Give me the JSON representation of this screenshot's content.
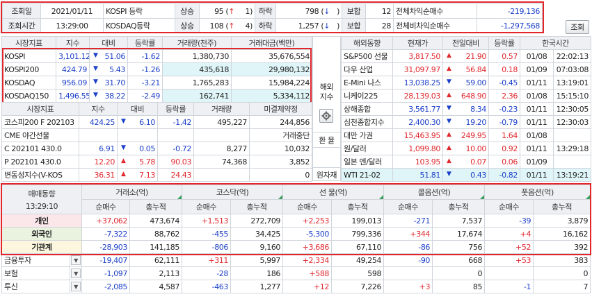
{
  "top": {
    "date_label": "조회일",
    "date_value": "2021/01/11",
    "time_label": "조회시간",
    "time_value": "13:29:00",
    "kospi_label": "KOSPI 등락",
    "kosdaq_label": "KOSDAQ등락",
    "up_label": "상승",
    "down_label": "하락",
    "flat_label": "보합",
    "kospi_up": "95",
    "kospi_up_limit": "1",
    "kospi_down": "798",
    "kospi_flat": "12",
    "kosdaq_up": "108",
    "kosdaq_up_limit": "4",
    "kosdaq_down": "1,257",
    "kosdaq_flat": "28",
    "total_diff_label": "전체차익순매수",
    "total_diff_value": "-219,136",
    "total_nondiff_label": "전체비차익순매수",
    "total_nondiff_value": "-1,297,568",
    "search_button": "조회",
    "up_arrow": "↑",
    "down_arrow": "↓"
  },
  "market": {
    "headers": [
      "시장지표",
      "지수",
      "대비",
      "등락률",
      "거래량(천주)",
      "거래대금(백만)"
    ],
    "rows": [
      {
        "name": "KOSPI",
        "index": "3,101.12",
        "change": "51.06",
        "rate": "-1.62",
        "volume": "1,380,730",
        "amount": "35,676,554"
      },
      {
        "name": "KOSPI200",
        "index": "424.79",
        "change": "5.43",
        "rate": "-1.26",
        "volume": "435,618",
        "amount": "29,980,132"
      },
      {
        "name": "KOSDAQ",
        "index": "956.09",
        "change": "31.70",
        "rate": "-3.21",
        "volume": "1,765,283",
        "amount": "15,984,224"
      },
      {
        "name": "KOSDAQ150",
        "index": "1,496.55",
        "change": "38.22",
        "rate": "-2.49",
        "volume": "162,741",
        "amount": "5,334,112"
      }
    ]
  },
  "futures": {
    "headers": [
      "시장지표",
      "지수",
      "대비",
      "등락률",
      "거래량",
      "미결제약정"
    ],
    "rows": [
      {
        "name": "코스피200 F 202103",
        "index": "424.25",
        "dir": "down",
        "change": "6.10",
        "rate": "-1.42",
        "volume": "495,227",
        "open": "244,856"
      },
      {
        "name": "CME 야간선물",
        "index": "",
        "dir": "",
        "change": "",
        "rate": "",
        "volume": "",
        "open": "거래중단"
      },
      {
        "name": "C 202101 430.0",
        "index": "6.91",
        "dir": "down",
        "change": "0.05",
        "rate": "-0.72",
        "volume": "8,277",
        "open": "10,032"
      },
      {
        "name": "P 202101 430.0",
        "index": "12.20",
        "dir": "up",
        "change": "5.78",
        "rate": "90.03",
        "volume": "74,368",
        "open": "3,852"
      },
      {
        "name": "변동성지수(V-KOS",
        "index": "36.31",
        "dir": "up",
        "change": "7.13",
        "rate": "24.43",
        "volume": "",
        "open": "0"
      }
    ]
  },
  "side": {
    "overseas": "해외지수",
    "fx": "환 율",
    "raw": "원자재"
  },
  "world": {
    "headers": [
      "해외동향",
      "현재가",
      "전일대비",
      "등락률",
      "한국시간"
    ],
    "rows": [
      {
        "name": "S&P500 선물",
        "price": "3,817.50",
        "dir": "up",
        "change": "21.90",
        "rate": "0.57",
        "date": "01/08",
        "time": "22:02:13"
      },
      {
        "name": "다우 산업",
        "price": "31,097.97",
        "dir": "up",
        "change": "56.84",
        "rate": "0.18",
        "date": "01/09",
        "time": "07:03:08"
      },
      {
        "name": "E-Mini 나스",
        "price": "13,038.25",
        "dir": "down",
        "change": "59.00",
        "rate": "-0.45",
        "date": "01/11",
        "time": "13:19:01"
      },
      {
        "name": "니케이225",
        "price": "28,139.03",
        "dir": "up",
        "change": "648.90",
        "rate": "2.36",
        "date": "01/08",
        "time": "15:15:10"
      },
      {
        "name": "상해종합",
        "price": "3,561.77",
        "dir": "down",
        "change": "8.34",
        "rate": "-0.23",
        "date": "01/11",
        "time": "12:30:05"
      },
      {
        "name": "심천종합지수",
        "price": "2,400.30",
        "dir": "down",
        "change": "19.20",
        "rate": "-0.79",
        "date": "01/11",
        "time": "12:30:03"
      },
      {
        "name": "대만 가권",
        "price": "15,463.95",
        "dir": "up",
        "change": "249.95",
        "rate": "1.64",
        "date": "01/08",
        "time": ""
      },
      {
        "name": "원/달러",
        "price": "1,099.80",
        "dir": "up",
        "change": "10.00",
        "rate": "0.92",
        "date": "01/11",
        "time": "13:29:18"
      },
      {
        "name": "일본 엔/달러",
        "price": "103.95",
        "dir": "up",
        "change": "0.07",
        "rate": "0.06",
        "date": "01/09",
        "time": ""
      },
      {
        "name": "WTI 21-02",
        "price": "51.81",
        "dir": "down",
        "change": "0.43",
        "rate": "-0.82",
        "date": "01/11",
        "time": "13:19:21"
      }
    ]
  },
  "investor": {
    "title": "매매동향",
    "time": "13:29:10",
    "groups": [
      "거래소(억)",
      "코스닥(억)",
      "선 물(억)",
      "콜옵션(억)",
      "풋옵션(억)"
    ],
    "net_label": "순매수",
    "cum_label": "총누적",
    "rows": [
      {
        "name": "개인",
        "vals": [
          "+37,062",
          "473,674",
          "+1,513",
          "272,709",
          "+2,253",
          "199,013",
          "-271",
          "7,537",
          "-39",
          "3,879"
        ]
      },
      {
        "name": "외국인",
        "vals": [
          "-7,322",
          "88,762",
          "-455",
          "34,425",
          "-5,300",
          "799,336",
          "+344",
          "17,674",
          "+4",
          "16,162"
        ]
      },
      {
        "name": "기관계",
        "vals": [
          "-28,903",
          "141,185",
          "-806",
          "9,160",
          "+3,686",
          "67,110",
          "-86",
          "756",
          "+52",
          "392"
        ]
      }
    ],
    "subrows": [
      {
        "name": "금융투자",
        "vals": [
          "-19,407",
          "62,111",
          "+311",
          "5,997",
          "+2,334",
          "49,254",
          "-90",
          "668",
          "+53",
          "383"
        ]
      },
      {
        "name": "보험",
        "vals": [
          "-1,097",
          "2,113",
          "-28",
          "186",
          "+588",
          "598",
          "",
          "0",
          "",
          "0"
        ]
      },
      {
        "name": "투신",
        "vals": [
          "-2,085",
          "4,587",
          "-463",
          "1,277",
          "+12",
          "7,226",
          "+3",
          "85",
          "-1",
          "7"
        ]
      }
    ]
  },
  "colors": {
    "up": "#e0282e",
    "down": "#1b3fc8",
    "highlight": "#e3262c"
  }
}
